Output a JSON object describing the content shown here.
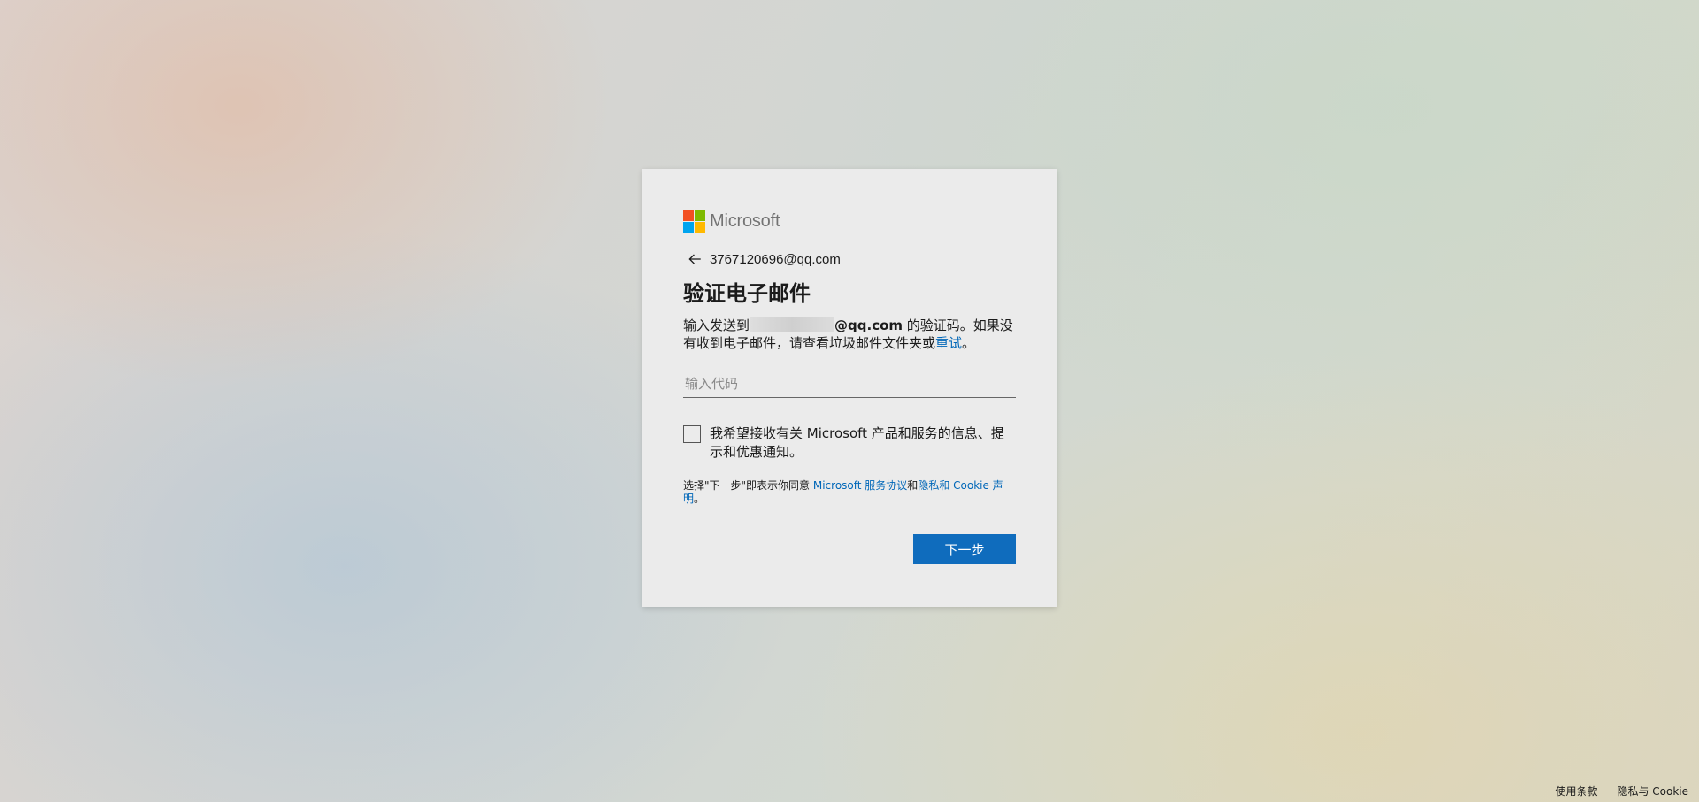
{
  "brand": {
    "name": "Microsoft",
    "colors": [
      "#f25022",
      "#7fba00",
      "#00a4ef",
      "#ffb900"
    ]
  },
  "identity": {
    "icon": "back-arrow-icon",
    "email": "3767120696@qq.com"
  },
  "title": "验证电子邮件",
  "description": {
    "prefix": "输入发送到",
    "email_domain": "@qq.com",
    "middle": " 的验证码。如果没有收到电子邮件，请查看垃圾邮件文件夹或",
    "retry_link": "重试",
    "suffix": "。"
  },
  "code_input": {
    "placeholder": "输入代码",
    "value": ""
  },
  "consent": {
    "label": "我希望接收有关 Microsoft 产品和服务的信息、提示和优惠通知。",
    "checked": false
  },
  "terms": {
    "prefix": "选择\"下一步\"即表示你同意 ",
    "service_link": "Microsoft 服务协议",
    "and": "和",
    "privacy_link": "隐私和 Cookie 声明",
    "suffix": "。"
  },
  "next_button": {
    "label": "下一步",
    "color": "#0f6cbd"
  },
  "footer": {
    "terms_link": "使用条款",
    "privacy_link": "隐私与 Cookie"
  }
}
